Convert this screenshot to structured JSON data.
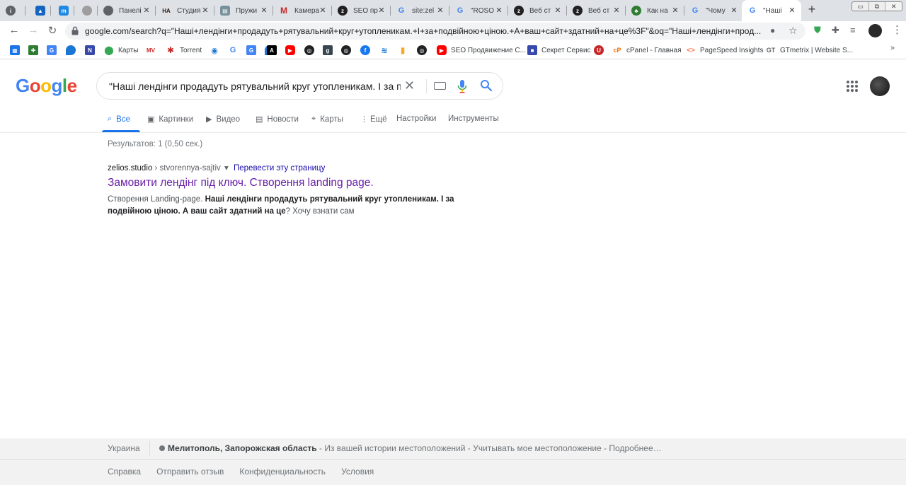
{
  "tabs": [
    {
      "icon": "i",
      "label": "",
      "color": "#5f6368"
    },
    {
      "icon": "chart-icon",
      "label": "",
      "color": "#1565c0"
    },
    {
      "icon": "m-icon",
      "label": "",
      "color": "#1e88e5"
    },
    {
      "icon": "globe-icon",
      "label": "",
      "color": "#9e9e9e"
    },
    {
      "icon": "globe-icon",
      "label": "Панелі",
      "color": "#5f6368"
    },
    {
      "icon": "НА",
      "label": "Студия",
      "color": "#5f6368"
    },
    {
      "icon": "doc-icon",
      "label": "Пружи",
      "color": "#5f6368"
    },
    {
      "icon": "M",
      "label": "Камера",
      "color": "#c62828"
    },
    {
      "icon": "z-icon",
      "label": "SEO пр",
      "color": "#212121"
    },
    {
      "icon": "G",
      "label": "site:zel",
      "color": "#4285f4"
    },
    {
      "icon": "G",
      "label": "\"ROSO",
      "color": "#4285f4"
    },
    {
      "icon": "z-icon",
      "label": "Веб ст",
      "color": "#212121"
    },
    {
      "icon": "z-icon",
      "label": "Веб ст",
      "color": "#212121"
    },
    {
      "icon": "leaf-icon",
      "label": "Как на",
      "color": "#2e7d32"
    },
    {
      "icon": "G",
      "label": "\"Чому",
      "color": "#4285f4"
    },
    {
      "icon": "G",
      "label": "\"Наші",
      "color": "#4285f4"
    }
  ],
  "new_tab_label": "+",
  "address": {
    "url": "google.com/search?q=\"Наші+лендінги+продадуть+рятувальний+круг+утопленикам.+І+за+подвійною+ціною.+А+ваш+сайт+здатний+на+це%3F\"&oq=\"Наші+лендінги+прод..."
  },
  "bookmarks": [
    {
      "icon": "grid-icon",
      "label": "",
      "color": "#1a73e8"
    },
    {
      "icon": "plus-icon",
      "label": "",
      "color": "#2e7d32"
    },
    {
      "icon": "translate-icon",
      "label": "",
      "color": "#4285f4"
    },
    {
      "icon": "drop-icon",
      "label": "",
      "color": "#1976d2"
    },
    {
      "icon": "n-icon",
      "label": "",
      "color": "#3949ab"
    },
    {
      "icon": "map-pin-icon",
      "label": "Карты",
      "color": "#34a853"
    },
    {
      "icon": "MV",
      "label": "",
      "color": "#c62828"
    },
    {
      "icon": "star-icon",
      "label": "Torrent",
      "color": "#c62828"
    },
    {
      "icon": "eye-icon",
      "label": "",
      "color": "#1976d2"
    },
    {
      "icon": "G",
      "label": "",
      "color": "#4285f4"
    },
    {
      "icon": "translate-icon",
      "label": "",
      "color": "#4285f4"
    },
    {
      "icon": "drop-icon",
      "label": "",
      "color": "#1976d2"
    },
    {
      "icon": "A",
      "label": "",
      "color": "#000000"
    },
    {
      "icon": "youtube-icon",
      "label": "",
      "color": "#ff0000"
    },
    {
      "icon": "globe-icon",
      "label": "",
      "color": "#202124"
    },
    {
      "icon": "g-icon",
      "label": "",
      "color": "#37474f"
    },
    {
      "icon": "globe-icon",
      "label": "",
      "color": "#202124"
    },
    {
      "icon": "facebook-icon",
      "label": "",
      "color": "#1877f2"
    },
    {
      "icon": "wifi-icon",
      "label": "",
      "color": "#1976d2"
    },
    {
      "icon": "bars-icon",
      "label": "",
      "color": "#f9a825"
    },
    {
      "icon": "globe-icon",
      "label": "",
      "color": "#202124"
    },
    {
      "icon": "youtube-icon",
      "label": "SEO Продвижение С...",
      "color": "#ff0000"
    },
    {
      "icon": "square-icon",
      "label": "Секрет Сервис",
      "color": "#3949ab"
    },
    {
      "icon": "u-icon",
      "label": "",
      "color": "#c62828"
    },
    {
      "icon": "cp-icon",
      "label": "cPanel - Главная",
      "color": "#ef6c00"
    },
    {
      "icon": "code-icon",
      "label": "PageSpeed Insights",
      "color": "#ff7043"
    },
    {
      "icon": "GT",
      "label": "GTmetrix | Website S...",
      "color": "#5f6368"
    }
  ],
  "logo": "Google",
  "search": {
    "query": "\"Наші лендінги продадуть рятувальний круг утопленикам. І за подві"
  },
  "search_tabs": [
    {
      "icon": "search-icon",
      "label": "Все"
    },
    {
      "icon": "image-icon",
      "label": "Картинки"
    },
    {
      "icon": "video-icon",
      "label": "Видео"
    },
    {
      "icon": "news-icon",
      "label": "Новости"
    },
    {
      "icon": "map-pin-icon",
      "label": "Карты"
    },
    {
      "icon": "more-vert-icon",
      "label": "Ещё"
    },
    {
      "icon": "",
      "label": "Настройки"
    },
    {
      "icon": "",
      "label": "Инструменты"
    }
  ],
  "stats": "Результатов: 1 (0,50 сек.)",
  "result": {
    "domain": "zelios.studio",
    "breadcrumb": "› stvorennya-sajtiv",
    "translate": "Перевести эту страницу",
    "title": "Замовити лендінг під ключ. Створення landing page.",
    "snippet_plain": "Створення Landing-page. ",
    "snippet_bold": "Наші лендінги продадуть рятувальний круг утопленикам. І за подвійною ціною. А ваш сайт здатний на це",
    "snippet_tail": "? Хочу взнати сам"
  },
  "footer": {
    "country": "Украина",
    "location_bold": "Мелитополь, Запорожская область",
    "location_rest": " - Из вашей истории местоположений - Учитывать мое местоположение - Подробнее…",
    "links": [
      "Справка",
      "Отправить отзыв",
      "Конфиденциальность",
      "Условия"
    ]
  },
  "colors": {
    "accent": "#1a73e8",
    "visited_link": "#681da8",
    "link": "#1a0dab",
    "google_blue": "#4285f4",
    "google_red": "#ea4335",
    "google_yellow": "#fbbc05",
    "google_green": "#34a853"
  }
}
